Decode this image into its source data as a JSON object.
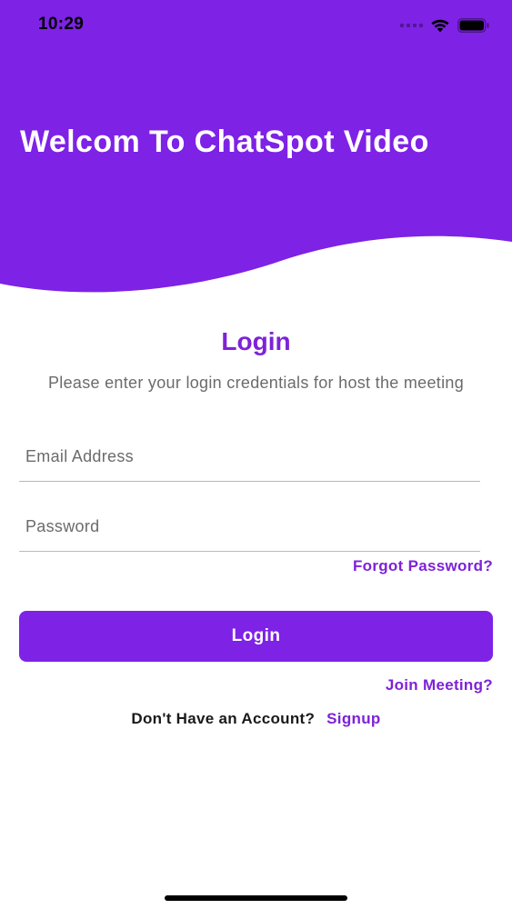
{
  "status_bar": {
    "time": "10:29"
  },
  "header": {
    "title": "Welcom To ChatSpot Video"
  },
  "login": {
    "heading": "Login",
    "subtitle": "Please enter your login credentials for host the meeting",
    "email_placeholder": "Email Address",
    "password_placeholder": "Password",
    "forgot_password": "Forgot Password?",
    "login_button": "Login",
    "join_meeting": "Join Meeting?",
    "signup_prompt": "Don't Have an Account?",
    "signup_link": "Signup"
  },
  "icons": {
    "signal": "cellular-signal-icon",
    "wifi": "wifi-icon",
    "battery": "battery-icon"
  },
  "colors": {
    "brand": "#7e22e6",
    "accent_text": "#7e22d8",
    "header_bg": "#7e22e6"
  }
}
